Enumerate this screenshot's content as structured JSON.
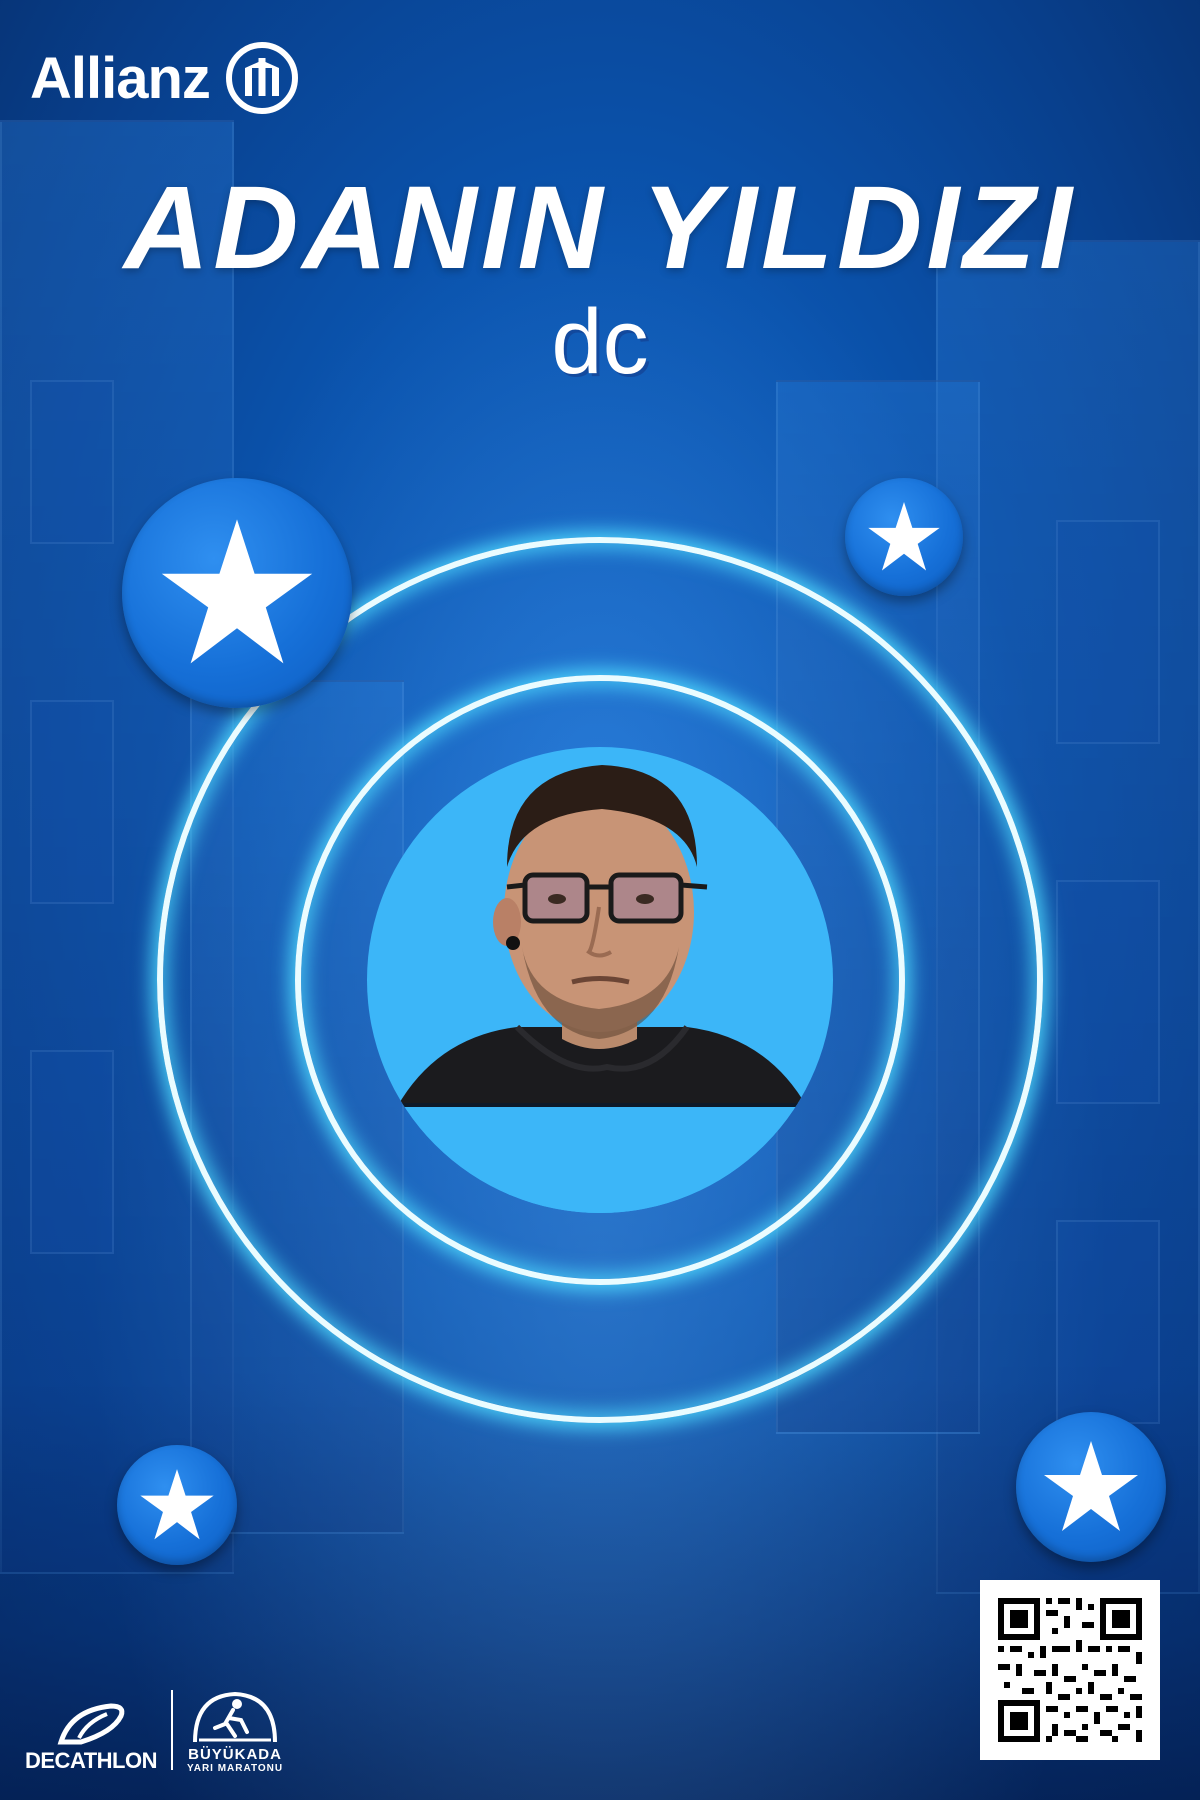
{
  "header": {
    "brand": "Allianz",
    "title": "ADANIN YILDIZI",
    "name": "dc"
  },
  "footer": {
    "sponsor": "DECATHLON",
    "event_name": "BÜYÜKADA",
    "event_sub": "YARI MARATONU"
  },
  "colors": {
    "background": "#0b55b0",
    "ring_glow": "#50dcff",
    "photo_bg": "#3cb6f8",
    "star_badge": "#1670d8",
    "text": "#ffffff"
  },
  "icons": {
    "brand_mark": "allianz-eagle-icon",
    "star": "star-icon",
    "qr": "qr-code",
    "sponsor_logo": "decathlon-logo-icon",
    "event_logo": "runner-icon"
  }
}
